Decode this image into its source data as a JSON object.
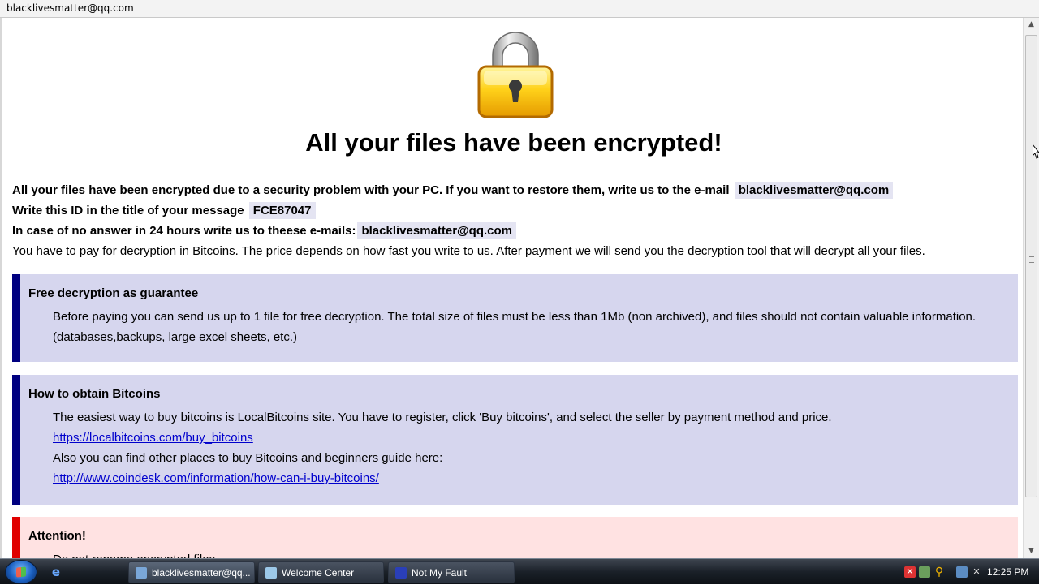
{
  "window": {
    "title": "blacklivesmatter@qq.com"
  },
  "main": {
    "heading": "All your files have been encrypted!",
    "line1_text": "All your files have been encrypted due to a security problem with your PC. If you want to restore them, write us to the e-mail",
    "line1_email": "blacklivesmatter@qq.com",
    "line2_text": "Write this ID in the title of your message",
    "line2_id": "FCE87047",
    "line3_text": "In case of no answer in 24 hours write us to theese e-mails:",
    "line3_email": "blacklivesmatter@qq.com",
    "line4_text": "You have to pay for decryption in Bitcoins. The price depends on how fast you write to us. After payment we will send you the decryption tool that will decrypt all your files."
  },
  "free_decryption": {
    "title": "Free decryption as guarantee",
    "text": "Before paying you can send us up to 1 file for free decryption. The total size of files must be less than 1Mb (non archived), and files should not contain valuable information. (databases,backups, large excel sheets, etc.)"
  },
  "bitcoins": {
    "title": "How to obtain Bitcoins",
    "text1": "The easiest way to buy bitcoins is LocalBitcoins site. You have to register, click 'Buy bitcoins', and select the seller by payment method and price.",
    "link1": "https://localbitcoins.com/buy_bitcoins",
    "text2": "Also you can find other places to buy Bitcoins and beginners guide here:",
    "link2": "http://www.coindesk.com/information/how-can-i-buy-bitcoins/"
  },
  "attention": {
    "title": "Attention!",
    "text": "Do not rename encrypted files."
  },
  "taskbar": {
    "buttons": [
      {
        "label": "blacklivesmatter@qq..."
      },
      {
        "label": "Welcome Center"
      },
      {
        "label": "Not My Fault"
      }
    ],
    "clock": "12:25 PM"
  },
  "colors": {
    "info_box_bg": "#d6d6ee",
    "info_box_border": "#000080",
    "attention_bg": "#ffe2e2",
    "attention_border": "#e00000",
    "link": "#0000cc"
  }
}
